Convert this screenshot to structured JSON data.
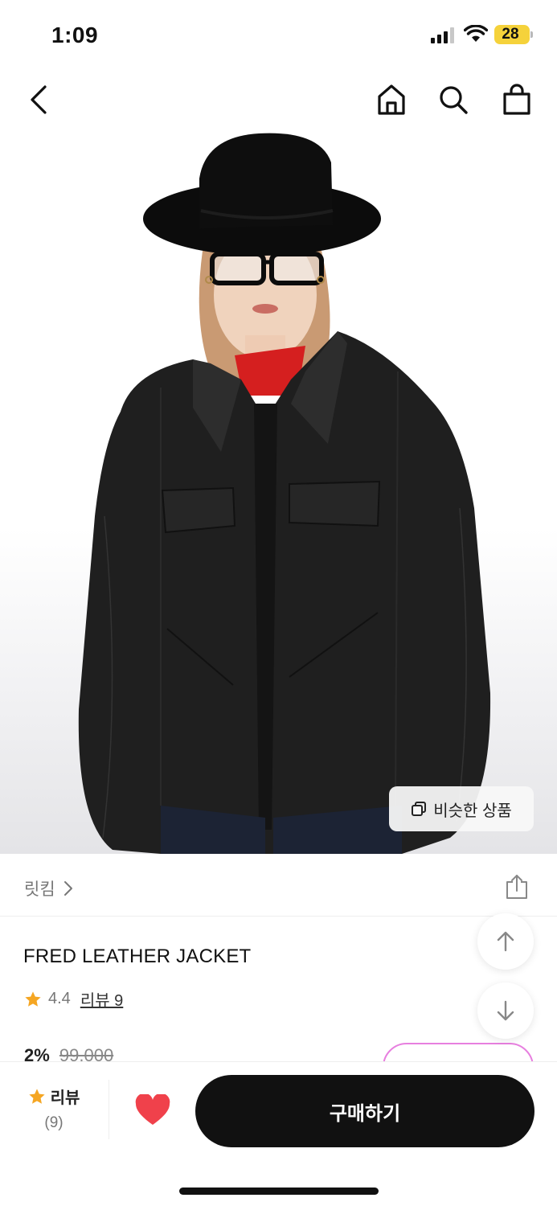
{
  "status_bar": {
    "time": "1:09",
    "battery": "28",
    "battery_color": "#f5d23b"
  },
  "nav": {
    "icons": [
      "back-icon",
      "home-icon",
      "search-icon",
      "shopping-bag-icon"
    ]
  },
  "image": {
    "similar_label": "비슷한 상품"
  },
  "brand": {
    "name": "릿킴"
  },
  "product": {
    "title": "FRED LEATHER JACKET",
    "rating": "4.4",
    "review_link": "리뷰 9",
    "discount": "2%",
    "original_price": "99,000"
  },
  "bottom_bar": {
    "review_label": "리뷰",
    "review_count": "(9)",
    "buy_label": "구매하기",
    "heart_color": "#f0414b"
  },
  "colors": {
    "accent": "#111111",
    "star": "#f5a623",
    "coupon_border": "#e77fdf"
  }
}
